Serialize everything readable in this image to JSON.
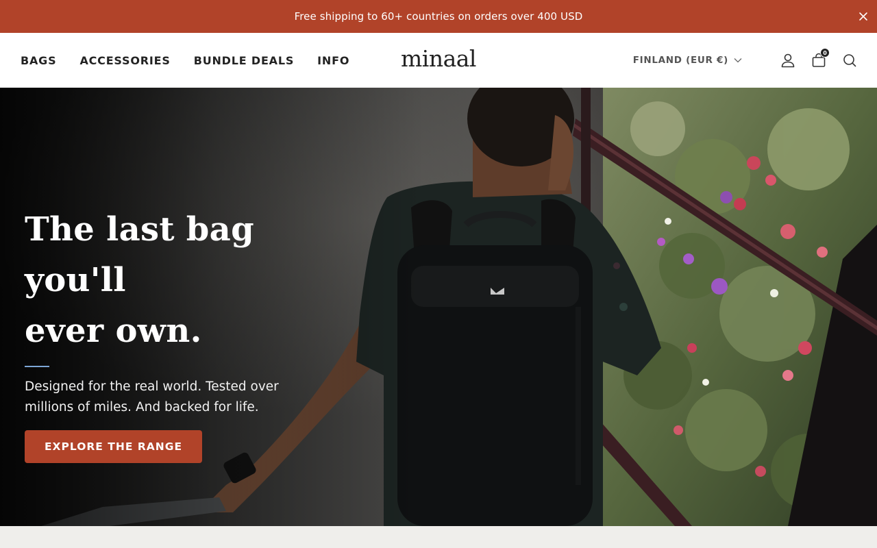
{
  "announcement": {
    "text": "Free shipping to 60+ countries on orders over 400 USD",
    "close_icon": "close-icon"
  },
  "header": {
    "nav": [
      {
        "label": "BAGS"
      },
      {
        "label": "ACCESSORIES"
      },
      {
        "label": "BUNDLE DEALS"
      },
      {
        "label": "INFO"
      }
    ],
    "logo": "minaal",
    "country_selector": "FINLAND (EUR €)",
    "cart_count": "0",
    "icons": [
      "chevron-down-icon",
      "account-icon",
      "cart-icon",
      "search-icon"
    ]
  },
  "hero": {
    "title_line1": "The last bag you'll",
    "title_line2": "ever own.",
    "subtitle": "Designed for the real world. Tested over millions of miles. And backed for life.",
    "cta_label": "EXPLORE THE RANGE"
  },
  "colors": {
    "brand_accent": "#b14329",
    "header_bg": "#ffffff",
    "text_dark": "#222222",
    "rule_accent": "#7da6d6",
    "page_bg": "#efeeeb"
  }
}
